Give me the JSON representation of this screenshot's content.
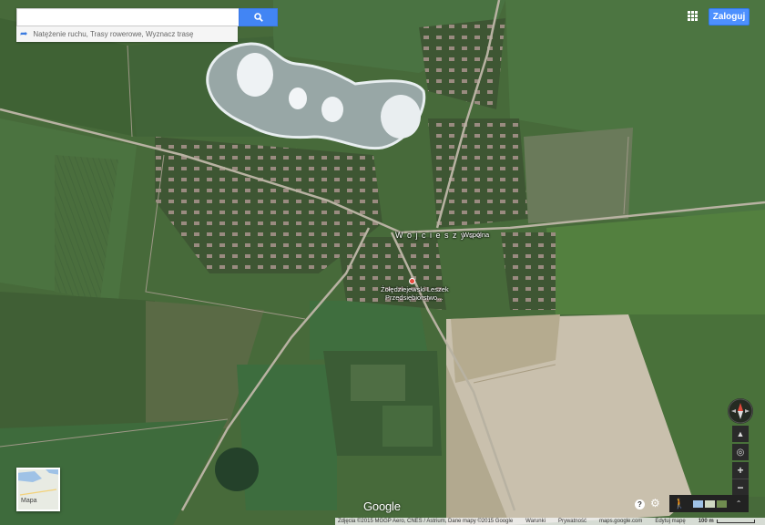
{
  "search": {
    "placeholder": "",
    "suggestion": "Natężenie ruchu, Trasy rowerowe, Wyznacz trasę"
  },
  "header": {
    "signin_label": "Zaloguj"
  },
  "map_labels": {
    "town": "W o j c i e s z y c e",
    "street": "Wspólna",
    "business_line1": "Żołędziejewski Leszek",
    "business_line2": "Przedsiębiorstwo..."
  },
  "minimap": {
    "label": "Mapa"
  },
  "logo": "Google",
  "footer": {
    "attribution": "Zdjęcia ©2015 MGGP Aero, CNES / Astrium, Dane mapy ©2015 Google",
    "terms": "Warunki",
    "privacy": "Prywatność",
    "domain": "maps.google.com",
    "edit": "Edytuj mapę",
    "scale": "100 m"
  },
  "colors": {
    "search_button": "#4285f4",
    "signin_button": "#4d90fe"
  },
  "icons": [
    "search-icon",
    "route-arrow-icon",
    "apps-grid-icon",
    "compass-icon",
    "tilt-icon",
    "my-location-icon",
    "zoom-in-icon",
    "zoom-out-icon",
    "help-icon",
    "gear-icon",
    "pegman-icon",
    "expand-icon"
  ]
}
